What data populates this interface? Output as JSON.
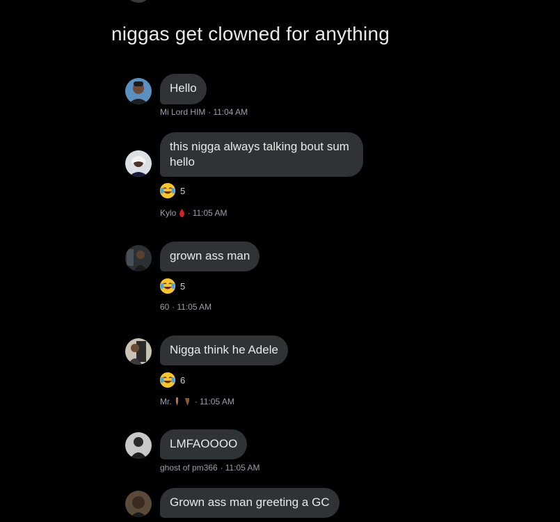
{
  "caption": "niggas get clowned for anything",
  "messages": [
    {
      "text": "Hello",
      "sender": "Mi Lord HIM",
      "time": "11:04 AM",
      "avatar_icon": "person-avatar-icon"
    },
    {
      "text": "this nigga always talking bout sum hello",
      "reaction_count": "5",
      "reaction_icon": "laughing-crying-emoji",
      "sender": "Kylo",
      "sender_emoji": "blood-drop-emoji",
      "time": "11:05 AM",
      "avatar_icon": "person-avatar-icon"
    },
    {
      "text": "grown ass man",
      "reaction_count": "5",
      "reaction_icon": "laughing-crying-emoji",
      "sender": "60",
      "time": "11:05 AM",
      "avatar_icon": "person-avatar-icon"
    },
    {
      "text": "Nigga think he Adele",
      "reaction_count": "6",
      "reaction_icon": "laughing-crying-emoji",
      "sender": "Mr.",
      "sender_emoji": "pointing-hands-emoji",
      "time": "11:05 AM",
      "avatar_icon": "person-avatar-icon"
    },
    {
      "text": "LMFAOOOO",
      "sender": "ghost of pm366",
      "time": "11:05 AM",
      "avatar_icon": "person-avatar-icon"
    },
    {
      "text": "Grown ass man greeting a GC",
      "avatar_icon": "person-avatar-icon"
    }
  ],
  "colors": {
    "background": "#000000",
    "bubble": "#2f3336",
    "meta_text": "#9aa0a6"
  }
}
